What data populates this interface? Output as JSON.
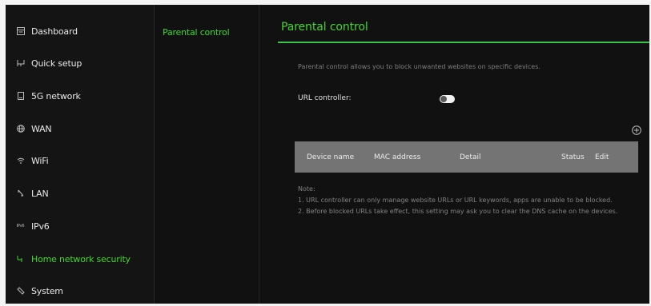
{
  "sidebar": {
    "items": [
      {
        "label": "Dashboard",
        "icon": "dashboard-icon"
      },
      {
        "label": "Quick setup",
        "icon": "quick-setup-icon"
      },
      {
        "label": "5G network",
        "icon": "5g-network-icon"
      },
      {
        "label": "WAN",
        "icon": "globe-icon"
      },
      {
        "label": "WiFi",
        "icon": "wifi-icon"
      },
      {
        "label": "LAN",
        "icon": "lan-icon"
      },
      {
        "label": "IPv6",
        "icon": "ipv6-icon"
      },
      {
        "label": "Home network security",
        "icon": "shield-key-icon",
        "active": true
      },
      {
        "label": "System",
        "icon": "system-icon"
      }
    ]
  },
  "subnav": {
    "items": [
      {
        "label": "Parental control",
        "active": true
      }
    ]
  },
  "main": {
    "title": "Parental control",
    "description": "Parental control allows you to block unwanted websites on specific devices.",
    "url_controller_label": "URL controller:",
    "url_controller_enabled": false,
    "table": {
      "headers": [
        "Device name",
        "MAC address",
        "Detail",
        "Status",
        "Edit"
      ]
    },
    "note": {
      "title": "Note:",
      "lines": [
        "1. URL controller can only manage website URLs or URL keywords, apps are unable to be blocked.",
        "2. Before blocked URLs take effect, this setting may ask you to clear the DNS cache on the devices."
      ]
    }
  },
  "colors": {
    "accent": "#44d62c",
    "background": "#111111",
    "table_header": "#747474"
  }
}
